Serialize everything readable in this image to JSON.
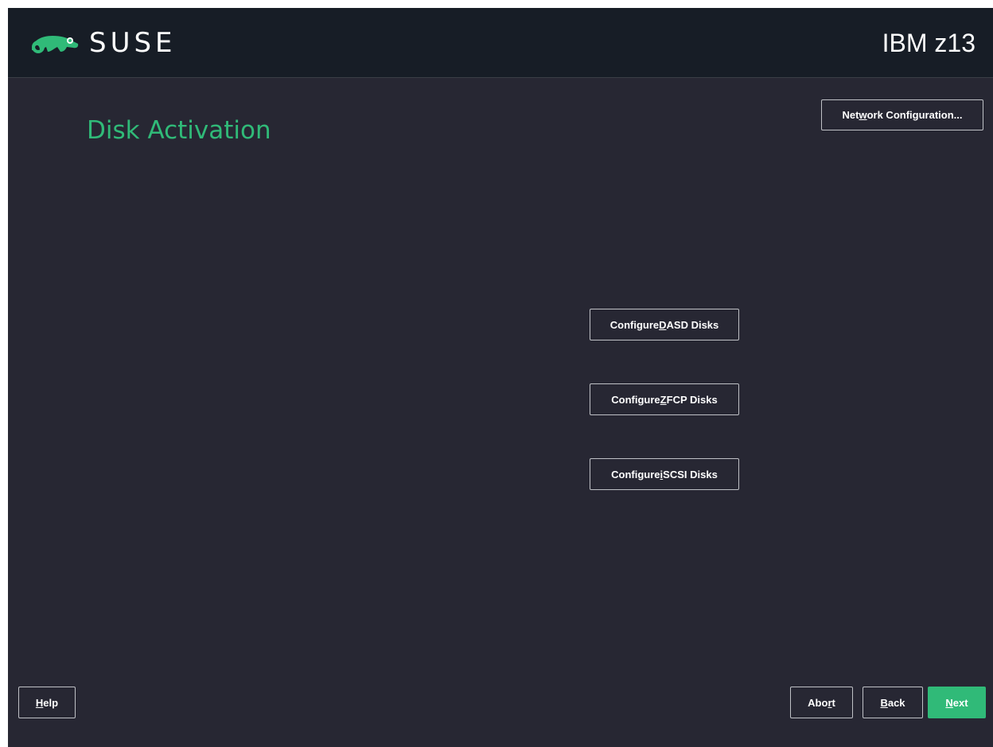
{
  "header": {
    "brand": "SUSE",
    "logo_icon": "chameleon-icon",
    "machine": "IBM z13"
  },
  "page": {
    "title": "Disk Activation"
  },
  "buttons": {
    "network": {
      "pre": "Net",
      "key": "w",
      "post": "ork Configuration..."
    },
    "dasd": {
      "pre": "Configure ",
      "key": "D",
      "post": "ASD Disks"
    },
    "zfcp": {
      "pre": "Configure ",
      "key": "Z",
      "post": "FCP Disks"
    },
    "iscsi": {
      "pre": "Configure ",
      "key": "i",
      "post": "SCSI Disks"
    },
    "help": {
      "pre": "",
      "key": "H",
      "post": "elp"
    },
    "abort": {
      "pre": "Abo",
      "key": "r",
      "post": "t"
    },
    "back": {
      "pre": "",
      "key": "B",
      "post": "ack"
    },
    "next": {
      "pre": "",
      "key": "N",
      "post": "ext"
    }
  },
  "colors": {
    "accent": "#30ba78",
    "background": "#272733",
    "header": "#171d26"
  }
}
